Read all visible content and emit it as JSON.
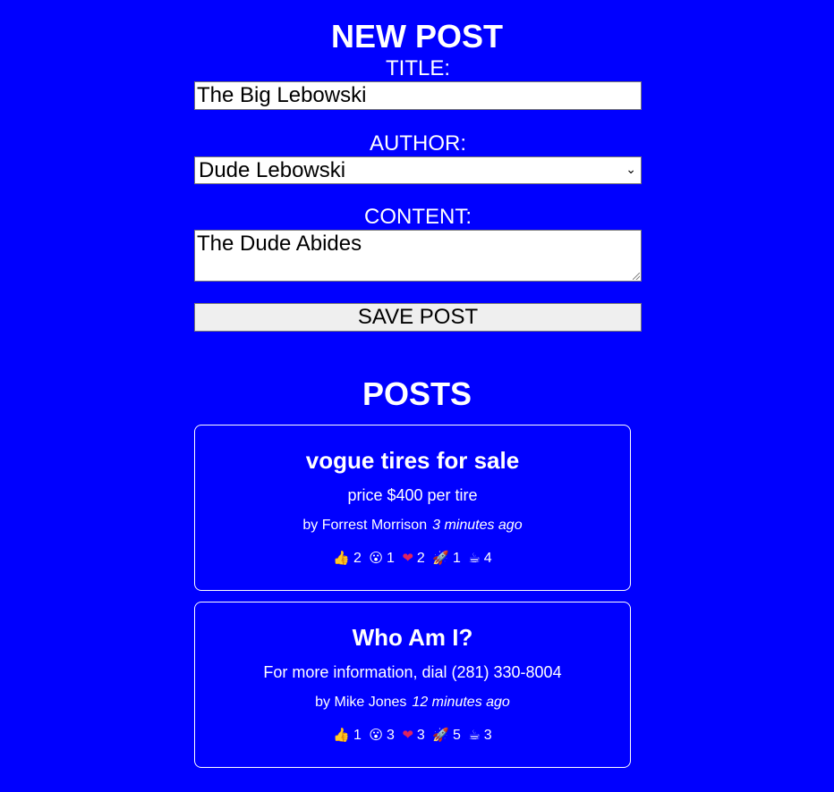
{
  "new_post": {
    "heading": "NEW POST",
    "title_label": "TITLE:",
    "title_value": "The Big Lebowski",
    "author_label": "AUTHOR:",
    "author_selected": "Dude Lebowski",
    "content_label": "CONTENT:",
    "content_value": "The Dude Abides",
    "save_label": "SAVE POST"
  },
  "posts_section": {
    "heading": "POSTS"
  },
  "posts": [
    {
      "title": "vogue tires for sale",
      "content": "price $400 per tire",
      "author": "by Forrest Morrison",
      "time": "3 minutes ago",
      "reactions": [
        {
          "icon": "thumbs-up-icon",
          "emoji": "👍",
          "count": "2"
        },
        {
          "icon": "wow-face-icon",
          "emoji": "😮",
          "count": "1"
        },
        {
          "icon": "heart-icon",
          "emoji": "❤",
          "count": "2"
        },
        {
          "icon": "rocket-icon",
          "emoji": "🚀",
          "count": "1"
        },
        {
          "icon": "coffee-icon",
          "emoji": "☕",
          "count": "4"
        }
      ]
    },
    {
      "title": "Who Am I?",
      "content": "For more information, dial (281) 330-8004",
      "author": "by Mike Jones",
      "time": "12 minutes ago",
      "reactions": [
        {
          "icon": "thumbs-up-icon",
          "emoji": "👍",
          "count": "1"
        },
        {
          "icon": "wow-face-icon",
          "emoji": "😮",
          "count": "3"
        },
        {
          "icon": "heart-icon",
          "emoji": "❤",
          "count": "3"
        },
        {
          "icon": "rocket-icon",
          "emoji": "🚀",
          "count": "5"
        },
        {
          "icon": "coffee-icon",
          "emoji": "☕",
          "count": "3"
        }
      ]
    }
  ],
  "colors": {
    "background": "#0000ff",
    "text": "#ffffff",
    "heart": "#e0245e"
  }
}
